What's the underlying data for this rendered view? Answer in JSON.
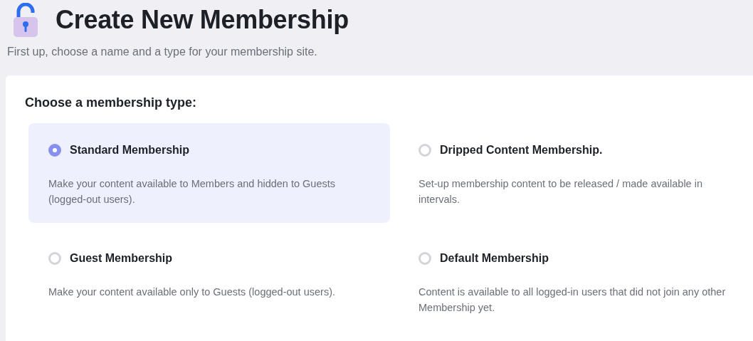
{
  "header": {
    "title": "Create New Membership",
    "subtitle": "First up, choose a name and a type for your membership site."
  },
  "card": {
    "heading": "Choose a membership type:",
    "options": [
      {
        "label": "Standard Membership",
        "description": "Make your content available to Members and hidden to Guests (logged-out users).",
        "selected": true
      },
      {
        "label": "Dripped Content Membership.",
        "description": "Set-up membership content to be released / made available in intervals.",
        "selected": false
      },
      {
        "label": "Guest Membership",
        "description": "Make your content available only to Guests (logged-out users).",
        "selected": false
      },
      {
        "label": "Default Membership",
        "description": "Content is available to all logged-in users that did not join any other Membership yet.",
        "selected": false
      }
    ]
  }
}
